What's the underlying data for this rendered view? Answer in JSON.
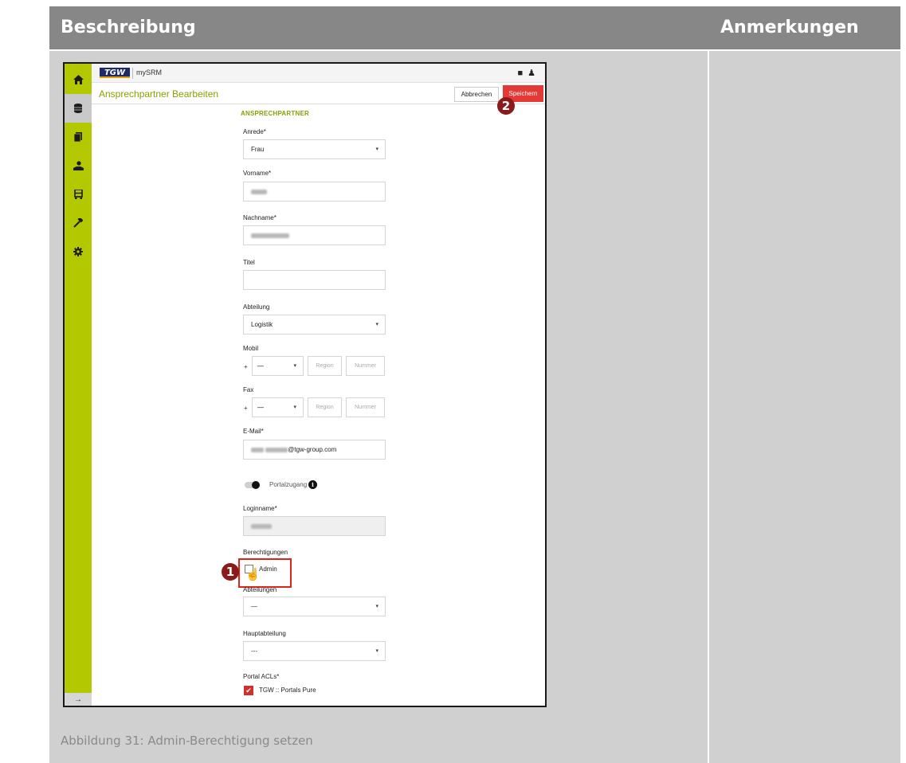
{
  "doc": {
    "header_left": "Beschreibung",
    "header_right": "Anmerkungen",
    "caption": "Abbildung 31: Admin-Berechtigung setzen"
  },
  "app": {
    "logo_text": "TGW",
    "name": "mySRM",
    "sidebar_icons": [
      "home-icon",
      "database-icon",
      "documents-icon",
      "user-hand-icon",
      "truck-icon",
      "hammer-icon",
      "gear-icon"
    ],
    "sidebar_expand_icon": "→"
  },
  "page": {
    "title": "Ansprechpartner Bearbeiten",
    "cancel_label": "Abbrechen",
    "save_label": "Speichern",
    "section_title": "ANSPRECHPARTNER"
  },
  "form": {
    "anrede": {
      "label": "Anrede*",
      "value": "Frau"
    },
    "vorname": {
      "label": "Vorname*"
    },
    "nachname": {
      "label": "Nachname*"
    },
    "titel": {
      "label": "Titel",
      "value": ""
    },
    "abteilung": {
      "label": "Abteilung",
      "value": "Logistik"
    },
    "mobil": {
      "label": "Mobil",
      "plus": "+",
      "country": "—",
      "region_placeholder": "Region",
      "number_placeholder": "Nummer"
    },
    "fax": {
      "label": "Fax",
      "plus": "+",
      "country": "—",
      "region_placeholder": "Region",
      "number_placeholder": "Nummer"
    },
    "email": {
      "label": "E-Mail*",
      "domain": "@tgw-group.com"
    },
    "portalzugang": {
      "label": "Portalzugang",
      "enabled": true
    },
    "loginname": {
      "label": "Loginname*"
    },
    "berechtigungen": {
      "label": "Berechtigungen",
      "admin_label": "Admin",
      "admin_checked": false
    },
    "abteilungen": {
      "label": "Abteilungen",
      "value": "—"
    },
    "hauptabteilung": {
      "label": "Hauptabteilung",
      "value": "---"
    },
    "portal_acls": {
      "label": "Portal ACLs*",
      "item_label": "TGW :: Portals Pure",
      "item_checked": true
    }
  },
  "markers": {
    "first": "1",
    "second": "2"
  },
  "colors": {
    "accent_green": "#b4c800",
    "title_green": "#8aa000",
    "save_red": "#e53935",
    "highlight_red": "#e0241b",
    "marker": "#8b1a1a"
  }
}
